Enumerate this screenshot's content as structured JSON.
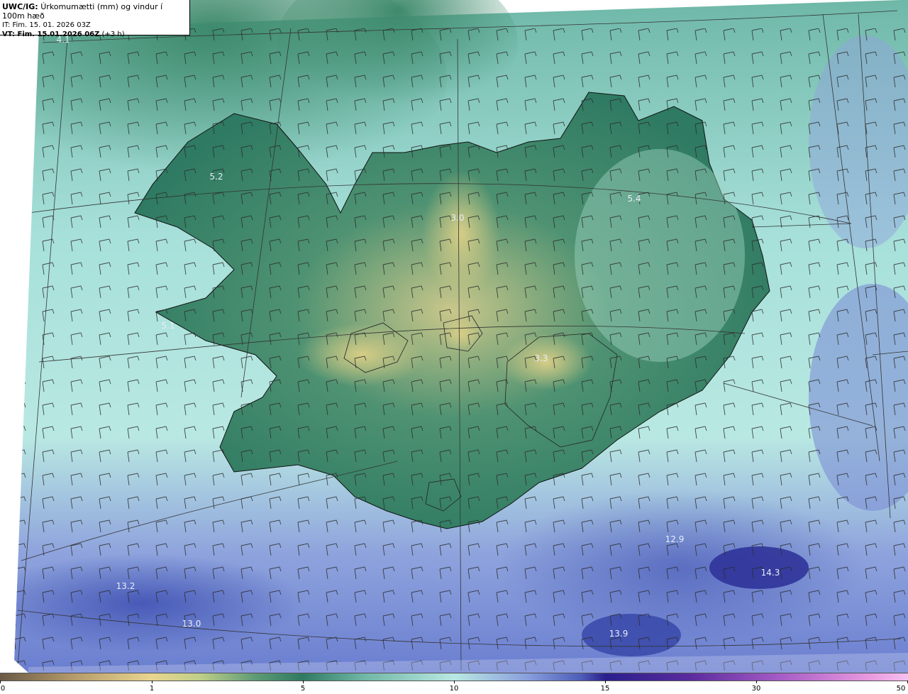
{
  "header": {
    "product": "UWC/IG:",
    "title": "Úrkomumætti (mm) og vindur í 100m hæð",
    "init_time": "IT: Fim. 15. 01. 2026 03Z",
    "valid_time_label": "VT: Fim. 15.01.2026 06Z",
    "valid_time_offset": "(+3 h)"
  },
  "colorbar": {
    "ticks": [
      "0",
      "1",
      "5",
      "10",
      "15",
      "30",
      "50"
    ]
  },
  "map_labels": [
    {
      "text": "4.1"
    },
    {
      "text": "5.2"
    },
    {
      "text": "5.4"
    },
    {
      "text": "3.0"
    },
    {
      "text": "5.1"
    },
    {
      "text": "3.3"
    },
    {
      "text": "12.9"
    },
    {
      "text": "14.3"
    },
    {
      "text": "13.2"
    },
    {
      "text": "13.0"
    },
    {
      "text": "13.9"
    }
  ],
  "colors": {
    "land_dark": "#2f7a62",
    "land_light": "#c7c98a",
    "sea_light": "#b9e8e2",
    "sea_blue": "#6e82cf",
    "coastline": "#000000",
    "label": "#e8eef7"
  }
}
